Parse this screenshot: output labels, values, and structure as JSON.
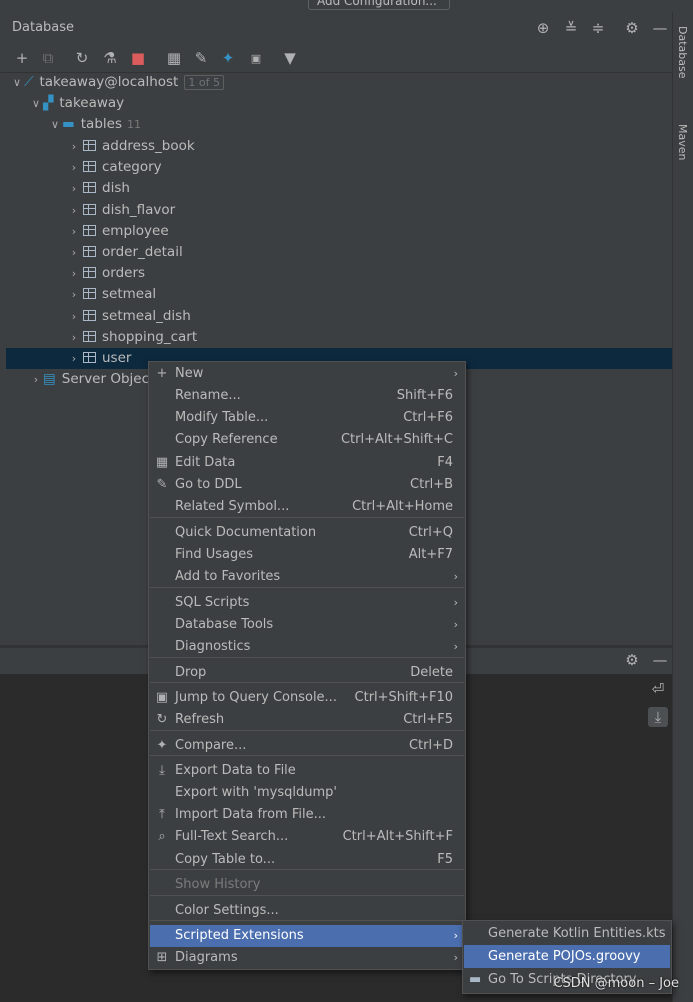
{
  "top": {
    "run_config_label": "Add Configuration..."
  },
  "right_strip": {
    "database_tab": "Database",
    "maven_tab": "Maven"
  },
  "panel": {
    "title": "Database"
  },
  "tree": {
    "connection": {
      "label": "takeaway@localhost",
      "badge": "1 of 5"
    },
    "schema": {
      "label": "takeaway"
    },
    "tables_folder": {
      "label": "tables",
      "count": "11"
    },
    "tables": [
      "address_book",
      "category",
      "dish",
      "dish_flavor",
      "employee",
      "order_detail",
      "orders",
      "setmeal",
      "setmeal_dish",
      "shopping_cart",
      "user"
    ],
    "server_objects": {
      "label": "Server Objects"
    }
  },
  "menu": {
    "items": [
      {
        "label": "New",
        "shortcut": "",
        "submenu": true,
        "icon": "plus-icon"
      },
      {
        "label": "Rename...",
        "shortcut": "Shift+F6"
      },
      {
        "label": "Modify Table...",
        "shortcut": "Ctrl+F6"
      },
      {
        "label": "Copy Reference",
        "shortcut": "Ctrl+Alt+Shift+C"
      },
      {
        "label": "Edit Data",
        "shortcut": "F4",
        "icon": "table-icon"
      },
      {
        "label": "Go to DDL",
        "shortcut": "Ctrl+B",
        "icon": "pencil-icon"
      },
      {
        "label": "Related Symbol...",
        "shortcut": "Ctrl+Alt+Home"
      },
      {
        "label": "Quick Documentation",
        "shortcut": "Ctrl+Q"
      },
      {
        "label": "Find Usages",
        "shortcut": "Alt+F7"
      },
      {
        "label": "Add to Favorites",
        "shortcut": "",
        "submenu": true
      },
      {
        "label": "SQL Scripts",
        "shortcut": "",
        "submenu": true
      },
      {
        "label": "Database Tools",
        "shortcut": "",
        "submenu": true
      },
      {
        "label": "Diagnostics",
        "shortcut": "",
        "submenu": true
      },
      {
        "label": "Drop",
        "shortcut": "Delete"
      },
      {
        "label": "Jump to Query Console...",
        "shortcut": "Ctrl+Shift+F10",
        "icon": "console-icon"
      },
      {
        "label": "Refresh",
        "shortcut": "Ctrl+F5",
        "icon": "refresh-icon"
      },
      {
        "label": "Compare...",
        "shortcut": "Ctrl+D",
        "icon": "compare-icon"
      },
      {
        "label": "Export Data to File",
        "shortcut": "",
        "icon": "export-icon"
      },
      {
        "label": "Export with 'mysqldump'",
        "shortcut": ""
      },
      {
        "label": "Import Data from File...",
        "shortcut": "",
        "icon": "import-icon"
      },
      {
        "label": "Full-Text Search...",
        "shortcut": "Ctrl+Alt+Shift+F",
        "icon": "search-icon"
      },
      {
        "label": "Copy Table to...",
        "shortcut": "F5"
      },
      {
        "label": "Show History",
        "shortcut": "",
        "disabled": true
      },
      {
        "label": "Color Settings...",
        "shortcut": ""
      },
      {
        "label": "Scripted Extensions",
        "shortcut": "",
        "submenu": true,
        "highlighted": true
      },
      {
        "label": "Diagrams",
        "shortcut": "",
        "submenu": true,
        "icon": "diagram-icon"
      }
    ]
  },
  "submenu": {
    "items": [
      "Generate Kotlin Entities.kts",
      "Generate POJOs.groovy",
      "Go To Scripts Directory"
    ]
  },
  "watermark": "CSDN @moon – Joe",
  "colors": {
    "selection": "#0d293e",
    "highlight": "#4b6eaf",
    "panel": "#3c3f41"
  }
}
